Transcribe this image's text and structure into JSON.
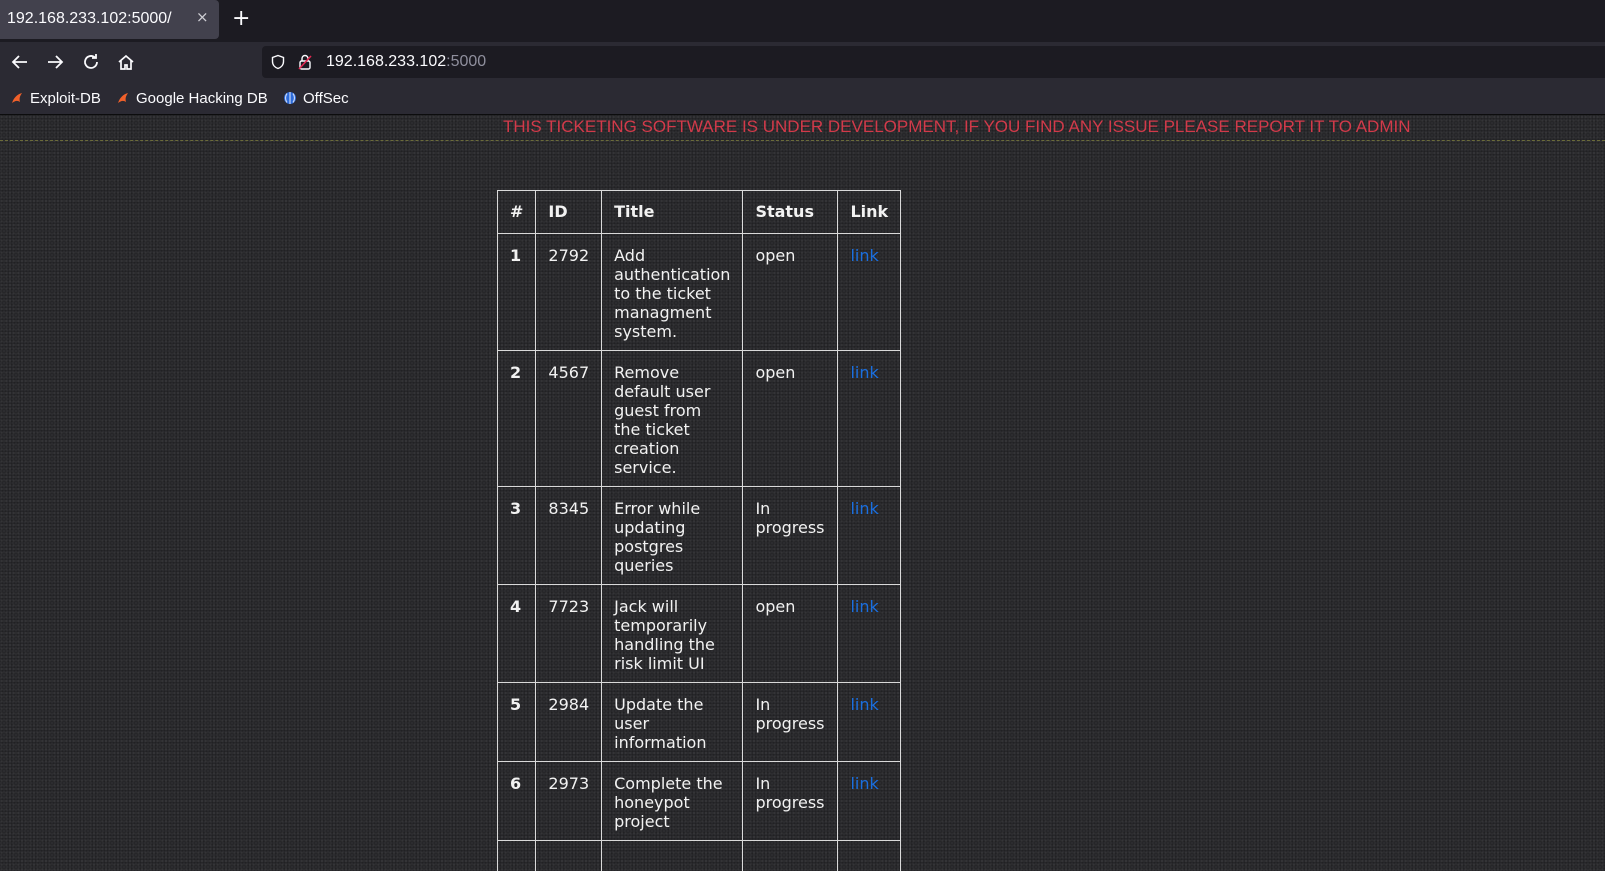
{
  "browser": {
    "tab_title": "192.168.233.102:5000/",
    "tab_close": "×",
    "new_tab": "+",
    "url_host": "192.168.233.102",
    "url_port": ":5000",
    "bookmarks": [
      {
        "label": "Exploit-DB",
        "icon": "exploit-db-icon"
      },
      {
        "label": "Google Hacking DB",
        "icon": "ghdb-icon"
      },
      {
        "label": "OffSec",
        "icon": "offsec-icon"
      }
    ]
  },
  "page": {
    "banner": "THIS TICKETING SOFTWARE IS UNDER DEVELOPMENT, IF YOU FIND ANY ISSUE PLEASE REPORT IT TO ADMIN",
    "colors": {
      "banner": "#d23a4a",
      "link": "#1a6fe0"
    },
    "table": {
      "headers": [
        "#",
        "ID",
        "Title",
        "Status",
        "Link"
      ],
      "rows": [
        {
          "num": "1",
          "id": "2792",
          "title": "Add authentication to the ticket managment system.",
          "status": "open",
          "link": "link"
        },
        {
          "num": "2",
          "id": "4567",
          "title": "Remove default user guest from the ticket creation service.",
          "status": "open",
          "link": "link"
        },
        {
          "num": "3",
          "id": "8345",
          "title": "Error while updating postgres queries",
          "status": "In progress",
          "link": "link"
        },
        {
          "num": "4",
          "id": "7723",
          "title": "Jack will temporarily handling the risk limit UI",
          "status": "open",
          "link": "link"
        },
        {
          "num": "5",
          "id": "2984",
          "title": "Update the user information",
          "status": "In progress",
          "link": "link"
        },
        {
          "num": "6",
          "id": "2973",
          "title": "Complete the honeypot project",
          "status": "In progress",
          "link": "link"
        }
      ]
    }
  }
}
